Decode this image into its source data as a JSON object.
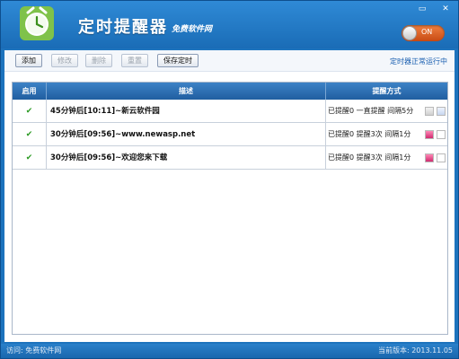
{
  "header": {
    "title": "定时提醒器",
    "subtitle": "免费软件网",
    "minimize_glyph": "▭",
    "close_glyph": "✕",
    "toggle_label": "ON"
  },
  "toolbar": {
    "add": "添加",
    "edit": "修改",
    "delete": "删除",
    "reset": "重置",
    "save": "保存定时",
    "status": "定时器正常运行中"
  },
  "table": {
    "headers": [
      "启用",
      "描述",
      "提醒方式"
    ],
    "rows": [
      {
        "enabled": "✔",
        "desc": "45分钟后[10:11]~新云软件园",
        "remind": "已提醒0  一直提醒  间隔5分"
      },
      {
        "enabled": "✔",
        "desc": "30分钟后[09:56]~www.newasp.net",
        "remind": "已提醒0  提醒3次  间隔1分"
      },
      {
        "enabled": "✔",
        "desc": "30分钟后[09:56]~欢迎您来下载",
        "remind": "已提醒0  提醒3次  间隔1分"
      }
    ]
  },
  "footer": {
    "left": "访问: 免费软件网",
    "right": "当前版本: 2013.11.05"
  },
  "colors": {
    "accent": "#1d73bd",
    "check": "#2b9a23",
    "toggle": "#e06a2a"
  }
}
